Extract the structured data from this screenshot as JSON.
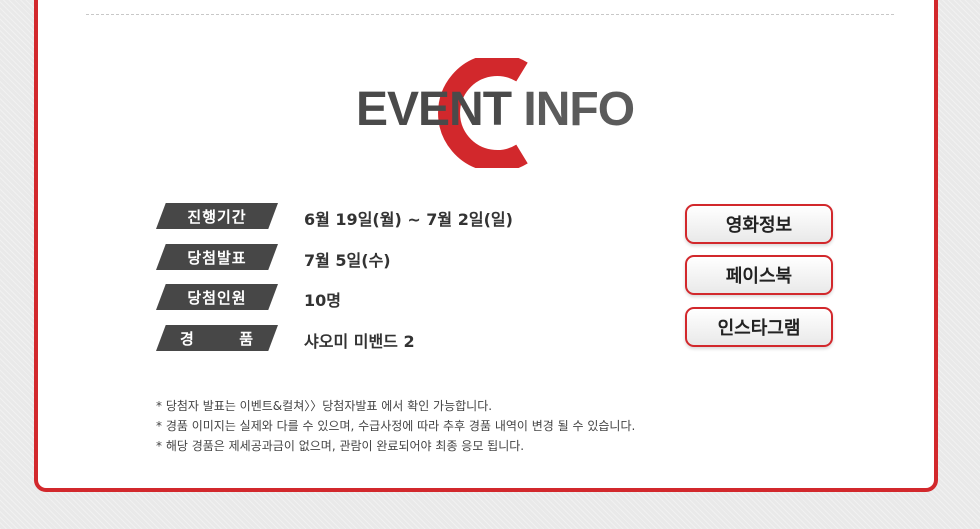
{
  "logo": {
    "word1": "EVENT",
    "word2": "INFO",
    "accent_color": "#d2282c"
  },
  "info_rows": [
    {
      "label": "진행기간",
      "value": "6월 19일(월) ~ 7월 2일(일)"
    },
    {
      "label": "당첨발표",
      "value": "7월 5일(수)"
    },
    {
      "label": "당첨인원",
      "value": "10명"
    },
    {
      "label_left": "경",
      "label_right": "품",
      "value": "샤오미 미밴드 2"
    }
  ],
  "buttons": {
    "movie_info": "영화정보",
    "facebook": "페이스북",
    "instagram": "인스타그램"
  },
  "notes": [
    "* 당첨자 발표는 이벤트&컬쳐〉〉당첨자발표 에서 확인 가능합니다.",
    "* 경품 이미지는 실제와 다를 수 있으며, 수급사정에 따라 추후 경품 내역이 변경 될 수 있습니다.",
    "* 해당 경품은 제세공과금이 없으며, 관람이 완료되어야 최종 응모 됩니다."
  ]
}
